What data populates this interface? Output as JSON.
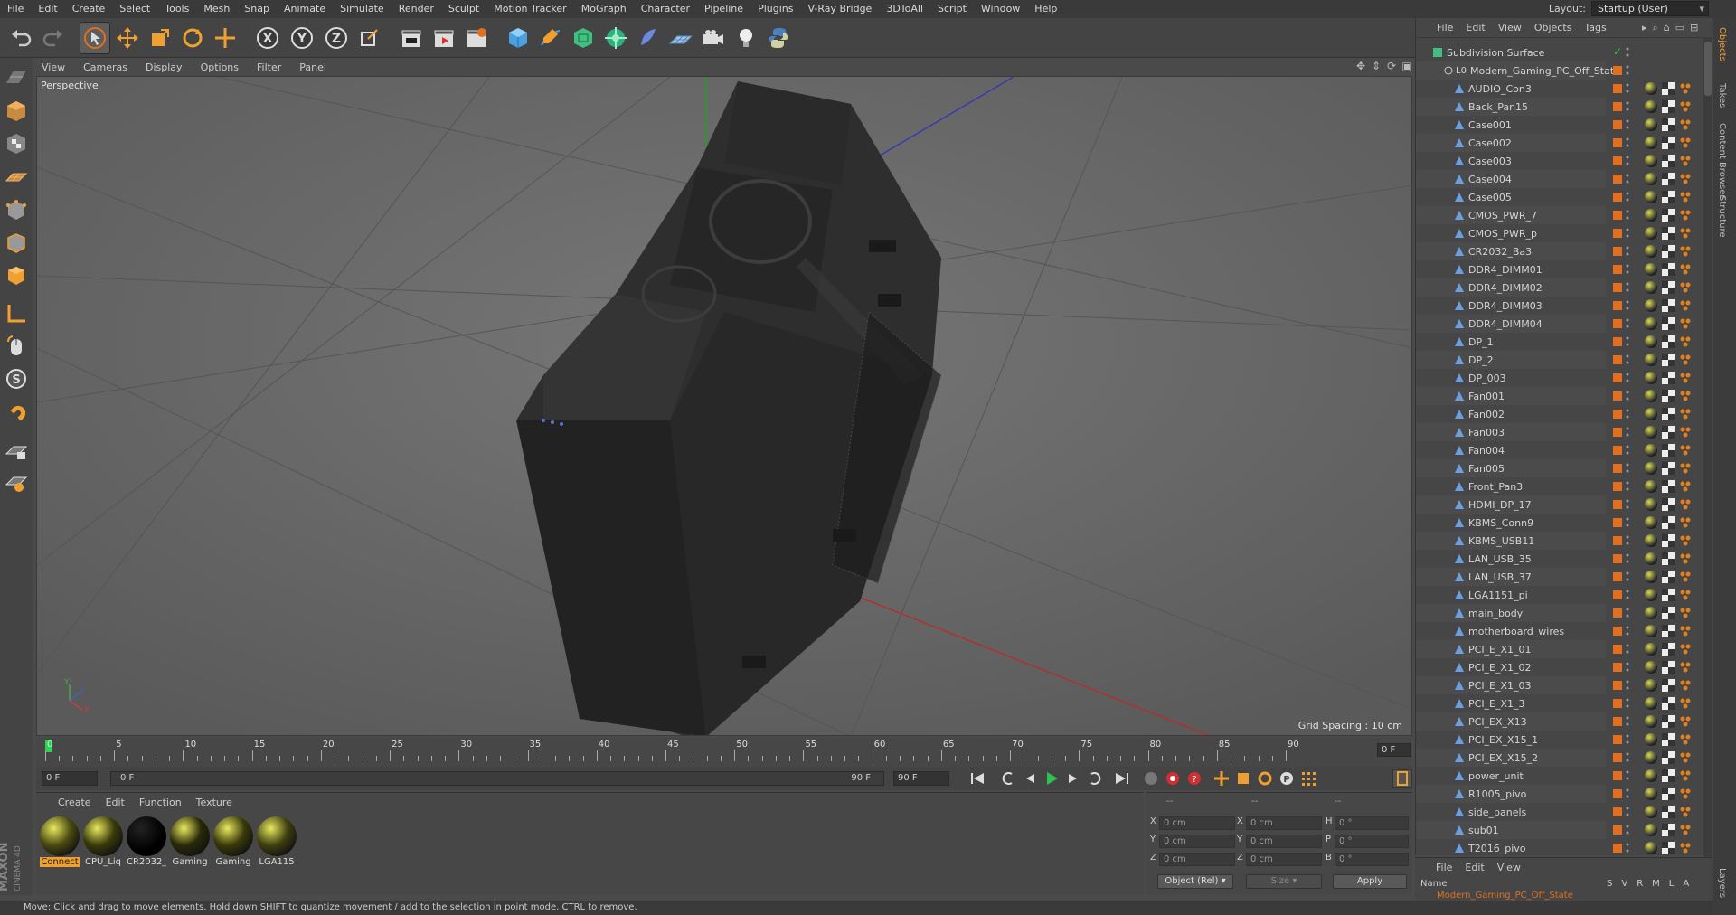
{
  "menu": [
    "File",
    "Edit",
    "Create",
    "Select",
    "Tools",
    "Mesh",
    "Snap",
    "Animate",
    "Simulate",
    "Render",
    "Sculpt",
    "Motion Tracker",
    "MoGraph",
    "Character",
    "Pipeline",
    "Plugins",
    "V-Ray Bridge",
    "3DToAll",
    "Script",
    "Window",
    "Help"
  ],
  "layout": {
    "label": "Layout:",
    "value": "Startup (User)"
  },
  "viewport": {
    "menu": [
      "View",
      "Cameras",
      "Display",
      "Options",
      "Filter",
      "Panel"
    ],
    "label": "Perspective",
    "grid_spacing": "Grid Spacing : 10 cm",
    "axis_labels": [
      "Y",
      "Z",
      "X"
    ]
  },
  "timeline": {
    "ticks": [
      "0",
      "5",
      "10",
      "15",
      "20",
      "25",
      "30",
      "35",
      "40",
      "45",
      "50",
      "55",
      "60",
      "65",
      "70",
      "75",
      "80",
      "85",
      "90"
    ],
    "current_frame_right": "0 F",
    "start_field": "0 F",
    "range_start": "0 F",
    "range_end": "90 F",
    "end_field": "90 F"
  },
  "materials": {
    "menu": [
      "Create",
      "Edit",
      "Function",
      "Texture"
    ],
    "items": [
      {
        "label": "Connect",
        "selected": true
      },
      {
        "label": "CPU_Liq",
        "selected": false
      },
      {
        "label": "CR2032_",
        "selected": false
      },
      {
        "label": "Gaming",
        "selected": false
      },
      {
        "label": "Gaming",
        "selected": false
      },
      {
        "label": "LGA115",
        "selected": false
      }
    ]
  },
  "coords": {
    "headers": [
      "--",
      "--",
      "--"
    ],
    "rows": [
      {
        "a": "X",
        "v1": "0 cm",
        "b": "X",
        "v2": "0 cm",
        "c": "H",
        "v3": "0 °"
      },
      {
        "a": "Y",
        "v1": "0 cm",
        "b": "Y",
        "v2": "0 cm",
        "c": "P",
        "v3": "0 °"
      },
      {
        "a": "Z",
        "v1": "0 cm",
        "b": "Z",
        "v2": "0 cm",
        "c": "B",
        "v3": "0 °"
      }
    ],
    "mode": "Object (Rel)",
    "size": "Size",
    "apply": "Apply"
  },
  "object_manager": {
    "menu": [
      "File",
      "Edit",
      "View",
      "Objects",
      "Tags"
    ],
    "root": "Subdivision Surface",
    "group": "Modern_Gaming_PC_Off_State",
    "group_prefix": "L0",
    "objects": [
      "AUDIO_Con3",
      "Back_Pan15",
      "Case001",
      "Case002",
      "Case003",
      "Case004",
      "Case005",
      "CMOS_PWR_7",
      "CMOS_PWR_p",
      "CR2032_Ba3",
      "DDR4_DIMM01",
      "DDR4_DIMM02",
      "DDR4_DIMM03",
      "DDR4_DIMM04",
      "DP_1",
      "DP_2",
      "DP_003",
      "Fan001",
      "Fan002",
      "Fan003",
      "Fan004",
      "Fan005",
      "Front_Pan3",
      "HDMI_DP_17",
      "KBMS_Conn9",
      "KBMS_USB11",
      "LAN_USB_35",
      "LAN_USB_37",
      "LGA1151_pi",
      "main_body",
      "motherboard_wires",
      "PCI_E_X1_01",
      "PCI_E_X1_02",
      "PCI_E_X1_03",
      "PCI_E_X1_3",
      "PCI_EX_X13",
      "PCI_EX_X15_1",
      "PCI_EX_X15_2",
      "power_unit",
      "R1005_pivo",
      "side_panels",
      "sub01",
      "T2016_pivo"
    ]
  },
  "layers": {
    "menu": [
      "File",
      "Edit",
      "View"
    ],
    "name_header": "Name",
    "cols": [
      "S",
      "V",
      "R",
      "M",
      "L",
      "A"
    ],
    "row": "Modern_Gaming_PC_Off_State"
  },
  "right_tabs": [
    "Objects",
    "Takes",
    "Content Browser",
    "Structure",
    "Layers"
  ],
  "brand": {
    "maxon": "MAXON",
    "product": "CINEMA 4D"
  },
  "status": "Move: Click and drag to move elements. Hold down SHIFT to quantize movement / add to the selection in point mode, CTRL to remove."
}
